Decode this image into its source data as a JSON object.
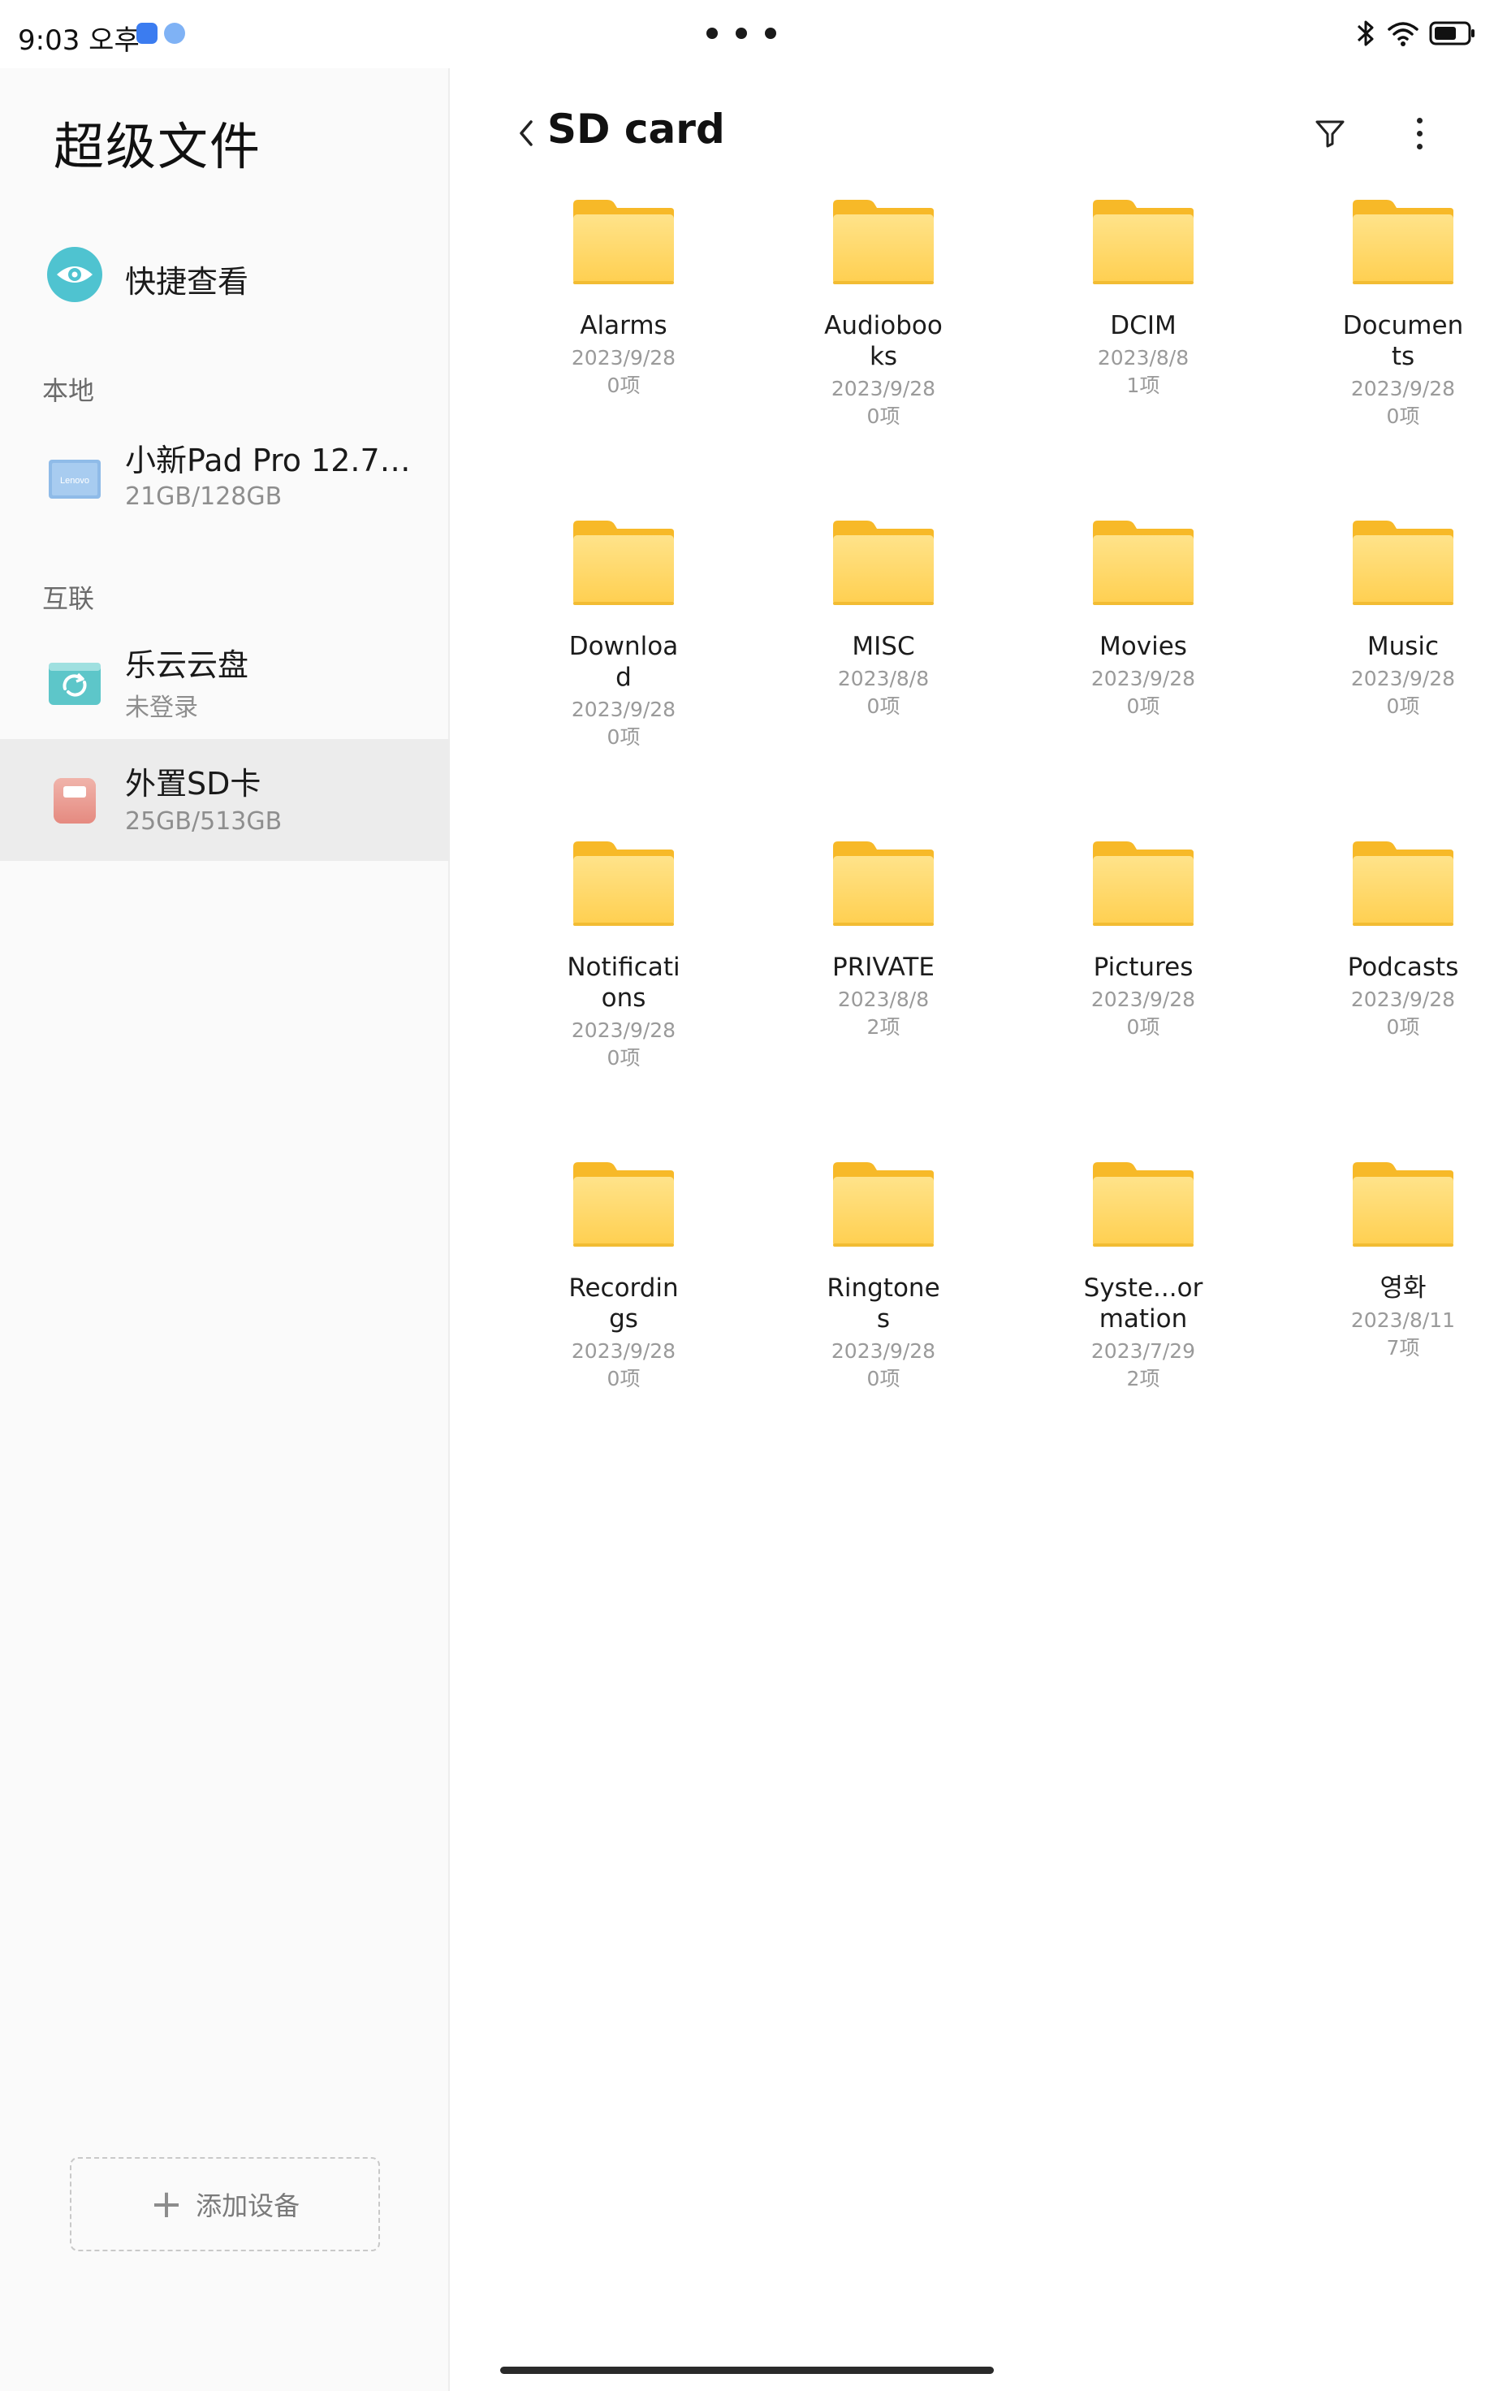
{
  "status_bar": {
    "time": "9:03 오후"
  },
  "sidebar": {
    "title": "超级文件",
    "quick_view": {
      "label": "快捷查看",
      "icon": "eye-icon"
    },
    "local_section": "本地",
    "local_device": {
      "name": "小新Pad Pro 12.7…",
      "storage": "21GB/128GB",
      "icon": "tablet-device-icon",
      "brand": "Lenovo"
    },
    "connected_section": "互联",
    "cloud": {
      "name": "乐云云盘",
      "status": "未登录",
      "icon": "cloud-sync-icon"
    },
    "sd_card": {
      "name": "外置SD卡",
      "storage": "25GB/513GB",
      "icon": "sd-card-icon",
      "selected": true
    },
    "add_device_label": "添加设备"
  },
  "main": {
    "title": "SD card",
    "folders": [
      {
        "name": "Alarms",
        "date": "2023/9/28",
        "count": "0项"
      },
      {
        "name": "Audiobooks",
        "date": "2023/9/28",
        "count": "0项"
      },
      {
        "name": "DCIM",
        "date": "2023/8/8",
        "count": "1项"
      },
      {
        "name": "Documents",
        "date": "2023/9/28",
        "count": "0项"
      },
      {
        "name": "Download",
        "date": "2023/9/28",
        "count": "0项"
      },
      {
        "name": "MISC",
        "date": "2023/8/8",
        "count": "0项"
      },
      {
        "name": "Movies",
        "date": "2023/9/28",
        "count": "0项"
      },
      {
        "name": "Music",
        "date": "2023/9/28",
        "count": "0项"
      },
      {
        "name": "Notifications",
        "date": "2023/9/28",
        "count": "0项"
      },
      {
        "name": "PRIVATE",
        "date": "2023/8/8",
        "count": "2项"
      },
      {
        "name": "Pictures",
        "date": "2023/9/28",
        "count": "0项"
      },
      {
        "name": "Podcasts",
        "date": "2023/9/28",
        "count": "0项"
      },
      {
        "name": "Recordings",
        "date": "2023/9/28",
        "count": "0项"
      },
      {
        "name": "Ringtones",
        "date": "2023/9/28",
        "count": "0项"
      },
      {
        "name": "Syste...ormation",
        "date": "2023/7/29",
        "count": "2项"
      },
      {
        "name": "영화",
        "date": "2023/8/11",
        "count": "7项"
      }
    ]
  },
  "colors": {
    "folder_body": "#FFD35C",
    "folder_tab": "#F7B928",
    "selected_bg": "#ECECEC",
    "quick_view_icon": "#4FC3D0",
    "sd_card_icon": "#E58A80"
  }
}
